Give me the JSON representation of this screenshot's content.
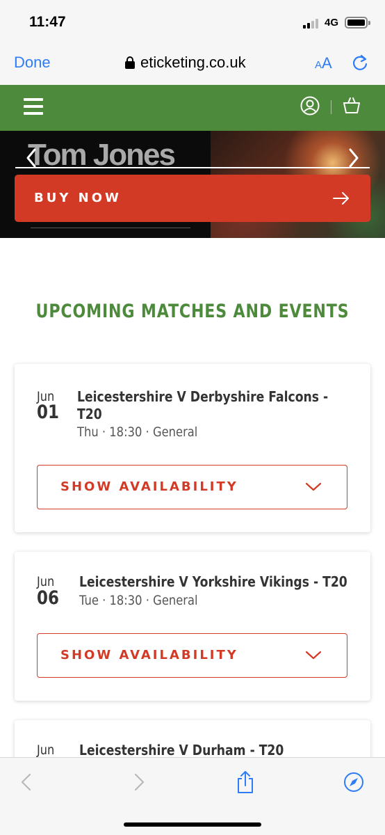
{
  "status_bar": {
    "time": "11:47",
    "network": "4G"
  },
  "browser": {
    "done_label": "Done",
    "url": "eticketing.co.uk",
    "text_size_label_small": "A",
    "text_size_label_large": "A"
  },
  "hero": {
    "title": "Tom Jones",
    "buy_label": "BUY NOW"
  },
  "section": {
    "title": "UPCOMING MATCHES AND EVENTS"
  },
  "events": [
    {
      "month": "Jun",
      "day": "01",
      "title_line1": "Leicestershire V Derbyshire Falcons -",
      "title_line2": "T20",
      "meta": "Thu · 18:30 · General",
      "button": "SHOW AVAILABILITY"
    },
    {
      "month": "Jun",
      "day": "06",
      "title_line1": "Leicestershire V Yorkshire Vikings - T20",
      "title_line2": "",
      "meta": "Tue · 18:30 · General",
      "button": "SHOW AVAILABILITY"
    },
    {
      "month": "Jun",
      "title_line1": "Leicestershire V Durham - T20"
    }
  ],
  "colors": {
    "brand_green": "#4e8a3c",
    "accent_red": "#d23a25",
    "ios_blue": "#2e7cf6"
  },
  "icons": [
    "signal-icon",
    "battery-icon",
    "lock-icon",
    "reload-icon",
    "hamburger-icon",
    "user-icon",
    "basket-icon",
    "chevron-left-icon",
    "chevron-right-icon",
    "arrow-right-icon",
    "chevron-down-icon",
    "back-icon",
    "forward-icon",
    "share-icon",
    "compass-icon"
  ]
}
